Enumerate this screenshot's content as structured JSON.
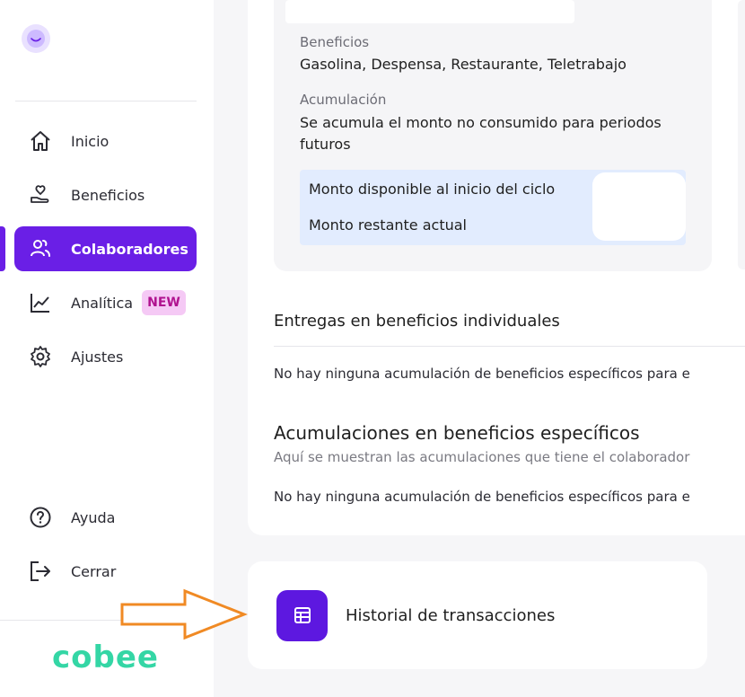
{
  "sidebar": {
    "nav": [
      {
        "label": "Inicio",
        "icon": "home-icon"
      },
      {
        "label": "Beneficios",
        "icon": "hand-heart-icon"
      },
      {
        "label": "Colaboradores",
        "icon": "users-icon",
        "active": true
      },
      {
        "label": "Analítica",
        "icon": "chart-line-icon",
        "badge": "NEW"
      },
      {
        "label": "Ajustes",
        "icon": "gear-icon"
      }
    ],
    "bottom": [
      {
        "label": "Ayuda",
        "icon": "help-circle-icon"
      },
      {
        "label": "Cerrar",
        "icon": "logout-icon"
      }
    ],
    "brand": "cobee"
  },
  "benefit_card": {
    "beneficios_label": "Beneficios",
    "beneficios_value": "Gasolina, Despensa, Restaurante, Teletrabajo",
    "acumulacion_label": "Acumulación",
    "acumulacion_value_line1": "Se acumula el monto no consumido para periodos",
    "acumulacion_value_line2": "futuros",
    "monto_inicio": "Monto disponible al inicio del ciclo",
    "monto_restante": "Monto restante actual"
  },
  "individual": {
    "title": "Entregas en beneficios individuales",
    "empty": "No hay ninguna acumulación de beneficios específicos para e"
  },
  "specific": {
    "title": "Acumulaciones en beneficios específicos",
    "subtitle": "Aquí se muestran las acumulaciones que tiene el colaborador",
    "empty": "No hay ninguna acumulación de beneficios específicos para e"
  },
  "history": {
    "label": "Historial de transacciones",
    "icon": "table-icon"
  },
  "colors": {
    "accent": "#6a1fe6",
    "brand": "#34d6a5",
    "arrow": "#f08a24"
  }
}
